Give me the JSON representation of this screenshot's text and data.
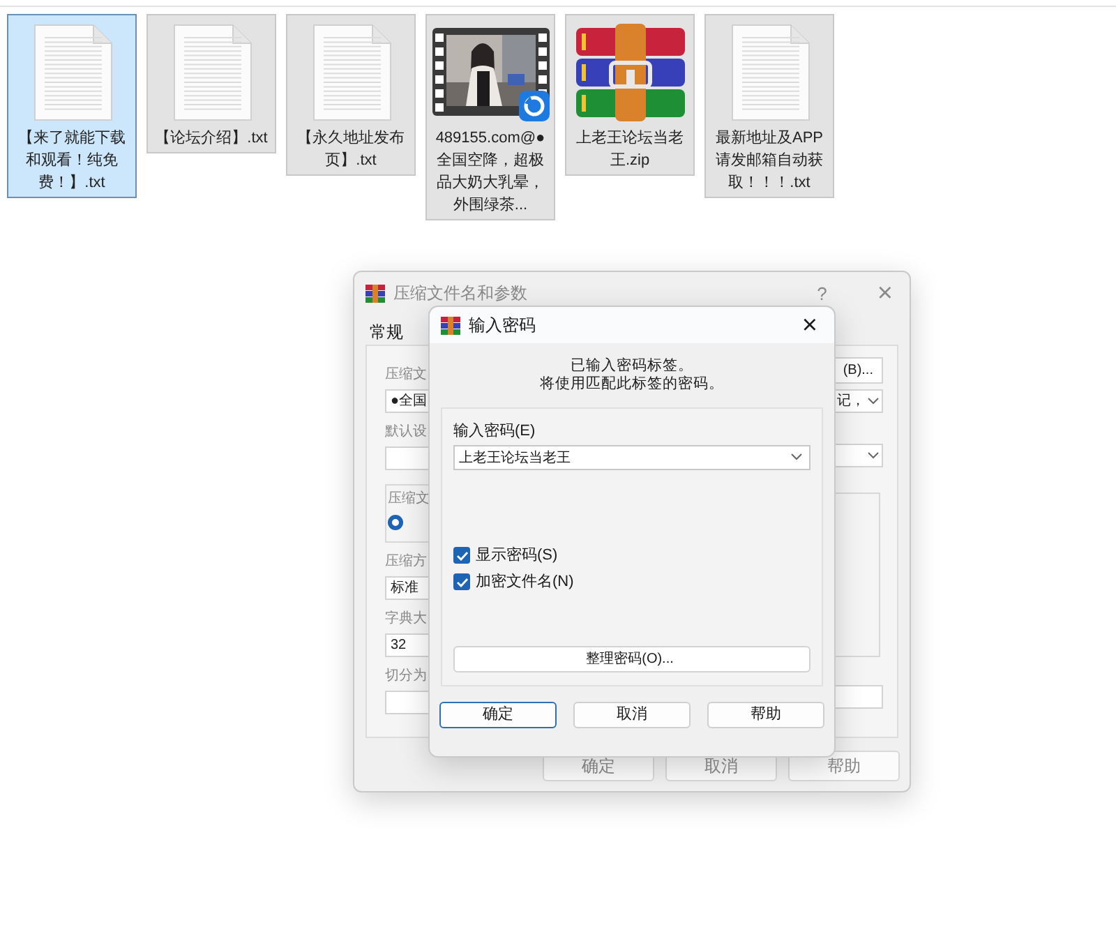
{
  "files": [
    {
      "name": "【来了就能下载和观看！纯免费！】.txt",
      "kind": "text",
      "selected": true
    },
    {
      "name": "【论坛介绍】.txt",
      "kind": "text",
      "selected": false
    },
    {
      "name": "【永久地址发布页】.txt",
      "kind": "text",
      "selected": false
    },
    {
      "name": "489155.com@●全国空降，超极品大奶大乳晕，外围绿茶...",
      "kind": "video",
      "selected": false
    },
    {
      "name": "上老王论坛当老王.zip",
      "kind": "archive",
      "selected": false
    },
    {
      "name": "最新地址及APP请发邮箱自动获取！！！.txt",
      "kind": "text",
      "selected": false
    }
  ],
  "back_dialog": {
    "title": "压缩文件名和参数",
    "help": "?",
    "close": "×",
    "tabs": [
      {
        "label": "常规",
        "selected": true
      }
    ],
    "left": [
      {
        "kind": "label",
        "text": "压缩文"
      },
      {
        "kind": "field",
        "text": "●全国"
      },
      {
        "kind": "label",
        "text": "默认设"
      },
      {
        "kind": "field"
      },
      {
        "kind": "group",
        "text": "压缩文",
        "radio_selected": true
      },
      {
        "kind": "label",
        "text": "压缩方"
      },
      {
        "kind": "field",
        "text": "标准"
      },
      {
        "kind": "label",
        "text": "字典大"
      },
      {
        "kind": "field",
        "text": "32"
      },
      {
        "kind": "label",
        "text": "切分为"
      },
      {
        "kind": "field"
      }
    ],
    "right": [
      {
        "kind": "button",
        "text": "(B)..."
      },
      {
        "kind": "combo",
        "text": "记，"
      },
      {
        "kind": "combo"
      },
      {
        "kind": "group"
      },
      {
        "kind": "field"
      }
    ],
    "buttons": [
      "确定",
      "取消",
      "帮助"
    ]
  },
  "password_dialog": {
    "title": "输入密码",
    "close": "×",
    "message": [
      "已输入密码标签。",
      "将使用匹配此标签的密码。"
    ],
    "field_label": "输入密码(E)",
    "password": "上老王论坛当老王",
    "options": [
      {
        "label": "显示密码(S)",
        "checked": true
      },
      {
        "label": "加密文件名(N)",
        "checked": true
      }
    ],
    "organize_button": "整理密码(O)...",
    "buttons": [
      {
        "label": "确定",
        "default": true
      },
      {
        "label": "取消",
        "default": false
      },
      {
        "label": "帮助",
        "default": false
      }
    ]
  }
}
